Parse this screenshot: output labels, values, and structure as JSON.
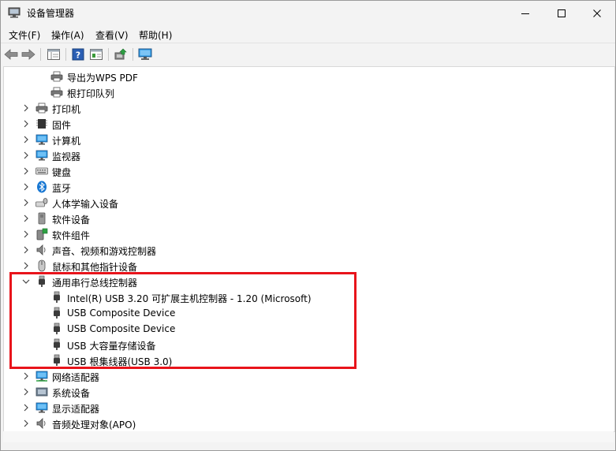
{
  "window": {
    "title": "设备管理器",
    "minimize_label": "minimize",
    "maximize_label": "maximize",
    "close_label": "close"
  },
  "menu": [
    {
      "label": "文件(F)"
    },
    {
      "label": "操作(A)"
    },
    {
      "label": "查看(V)"
    },
    {
      "label": "帮助(H)"
    }
  ],
  "toolbar": [
    "back-arrow-icon",
    "forward-arrow-icon",
    "properties-panel-icon",
    "help-icon",
    "detail-view-icon",
    "update-driver-icon",
    "monitor-scan-icon"
  ],
  "tree": {
    "rows": [
      {
        "label": "导出为WPS PDF",
        "icon": "printer-icon",
        "level": 2,
        "expander": "none"
      },
      {
        "label": "根打印队列",
        "icon": "printer-icon",
        "level": 2,
        "expander": "none"
      },
      {
        "label": "打印机",
        "icon": "printer-icon",
        "level": 1,
        "expander": "collapsed"
      },
      {
        "label": "固件",
        "icon": "firmware-icon",
        "level": 1,
        "expander": "collapsed"
      },
      {
        "label": "计算机",
        "icon": "computer-icon",
        "level": 1,
        "expander": "collapsed"
      },
      {
        "label": "监视器",
        "icon": "monitor-icon",
        "level": 1,
        "expander": "collapsed"
      },
      {
        "label": "键盘",
        "icon": "keyboard-icon",
        "level": 1,
        "expander": "collapsed"
      },
      {
        "label": "蓝牙",
        "icon": "bluetooth-icon",
        "level": 1,
        "expander": "collapsed"
      },
      {
        "label": "人体学输入设备",
        "icon": "hid-icon",
        "level": 1,
        "expander": "collapsed"
      },
      {
        "label": "软件设备",
        "icon": "software-device-icon",
        "level": 1,
        "expander": "collapsed"
      },
      {
        "label": "软件组件",
        "icon": "software-component-icon",
        "level": 1,
        "expander": "collapsed"
      },
      {
        "label": "声音、视频和游戏控制器",
        "icon": "speaker-icon",
        "level": 1,
        "expander": "collapsed"
      },
      {
        "label": "鼠标和其他指针设备",
        "icon": "mouse-icon",
        "level": 1,
        "expander": "collapsed"
      },
      {
        "label": "通用串行总线控制器",
        "icon": "usb-icon",
        "level": 1,
        "expander": "expanded"
      },
      {
        "label": "Intel(R) USB 3.20 可扩展主机控制器 - 1.20 (Microsoft)",
        "icon": "usb-icon",
        "level": 2,
        "expander": "none"
      },
      {
        "label": "USB Composite Device",
        "icon": "usb-icon",
        "level": 2,
        "expander": "none"
      },
      {
        "label": "USB Composite Device",
        "icon": "usb-icon",
        "level": 2,
        "expander": "none"
      },
      {
        "label": "USB 大容量存储设备",
        "icon": "usb-icon",
        "level": 2,
        "expander": "none"
      },
      {
        "label": "USB 根集线器(USB 3.0)",
        "icon": "usb-icon",
        "level": 2,
        "expander": "none"
      },
      {
        "label": "网络适配器",
        "icon": "network-icon",
        "level": 1,
        "expander": "collapsed"
      },
      {
        "label": "系统设备",
        "icon": "system-device-icon",
        "level": 1,
        "expander": "collapsed"
      },
      {
        "label": "显示适配器",
        "icon": "display-adapter-icon",
        "level": 1,
        "expander": "collapsed"
      },
      {
        "label": "音频处理对象(APO)",
        "icon": "speaker-icon",
        "level": 1,
        "expander": "collapsed"
      }
    ]
  },
  "colors": {
    "highlight_border": "#e8141b",
    "monitor_blue": "#1e90e0",
    "bluetooth_blue": "#1877d2"
  }
}
